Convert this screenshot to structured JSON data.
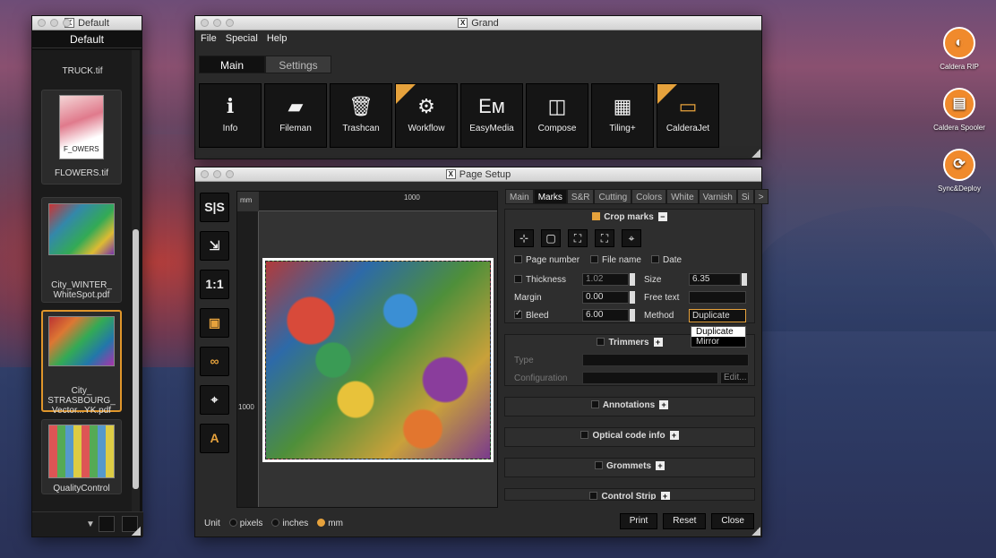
{
  "desktop": {
    "icons": [
      {
        "label": "Caldera RIP",
        "glyph": "◐"
      },
      {
        "label": "Caldera Spooler",
        "glyph": "▤"
      },
      {
        "label": "Sync&Deploy",
        "glyph": "⟳"
      }
    ]
  },
  "default_window": {
    "title": "Default",
    "header": "Default",
    "items": [
      {
        "label": "TRUCK.tif"
      },
      {
        "label": "FLOWERS.tif",
        "thumb_text": "F_OWERS"
      },
      {
        "label": "City_WINTER_\nWhiteSpot.pdf"
      },
      {
        "label": "City_\nSTRASBOURG_\nVector...YK.pdf"
      },
      {
        "label": "QualityControl"
      }
    ]
  },
  "grand_window": {
    "title": "Grand",
    "menu": [
      "File",
      "Special",
      "Help"
    ],
    "tabs": [
      "Main",
      "Settings"
    ],
    "tools": [
      {
        "label": "Info",
        "glyph": "i",
        "flag": false
      },
      {
        "label": "Fileman",
        "glyph": "▰",
        "flag": false
      },
      {
        "label": "Trashcan",
        "glyph": "🗑",
        "flag": false
      },
      {
        "label": "Workflow",
        "glyph": "⚙",
        "flag": true
      },
      {
        "label": "EasyMedia",
        "glyph": "Eм",
        "flag": false
      },
      {
        "label": "Compose",
        "glyph": "◫",
        "flag": false
      },
      {
        "label": "Tiling+",
        "glyph": "▦",
        "flag": false
      },
      {
        "label": "CalderaJet",
        "glyph": "▭",
        "flag": true
      }
    ]
  },
  "page_window": {
    "title": "Page Setup",
    "left_tools": [
      "S|S",
      "⇲",
      "1:1",
      "▣",
      "∞",
      "⌖",
      "A"
    ],
    "ruler": {
      "unit": "mm",
      "top_mark": "1000",
      "left_mark": "1000"
    },
    "tabs": [
      "Main",
      "Marks",
      "S&R",
      "Cutting",
      "Colors",
      "White",
      "Varnish",
      "Si",
      ">"
    ],
    "crop_marks": {
      "title": "Crop marks",
      "buttons": [
        "⊹",
        "▢",
        "⛶",
        "⛶",
        "⌖"
      ],
      "page_number": "Page number",
      "file_name": "File name",
      "date": "Date",
      "thickness_label": "Thickness",
      "thickness_value": "1.02",
      "size_label": "Size",
      "size_value": "6.35",
      "margin_label": "Margin",
      "margin_value": "0.00",
      "free_text_label": "Free text",
      "bleed_label": "Bleed",
      "bleed_value": "6.00",
      "method_label": "Method",
      "method_value": "Duplicate",
      "method_options": [
        "Duplicate",
        "Mirror"
      ]
    },
    "trimmers": {
      "title": "Trimmers",
      "type_label": "Type",
      "config_label": "Configuration",
      "edit_label": "Edit..."
    },
    "collapsed_sections": [
      "Annotations",
      "Optical code info",
      "Grommets",
      "Control Strip"
    ],
    "unit": {
      "label": "Unit",
      "options": [
        "pixels",
        "inches",
        "mm"
      ],
      "selected": "mm"
    },
    "buttons": [
      "Print",
      "Reset",
      "Close"
    ]
  },
  "colors": {
    "accent": "#e6a23c"
  }
}
